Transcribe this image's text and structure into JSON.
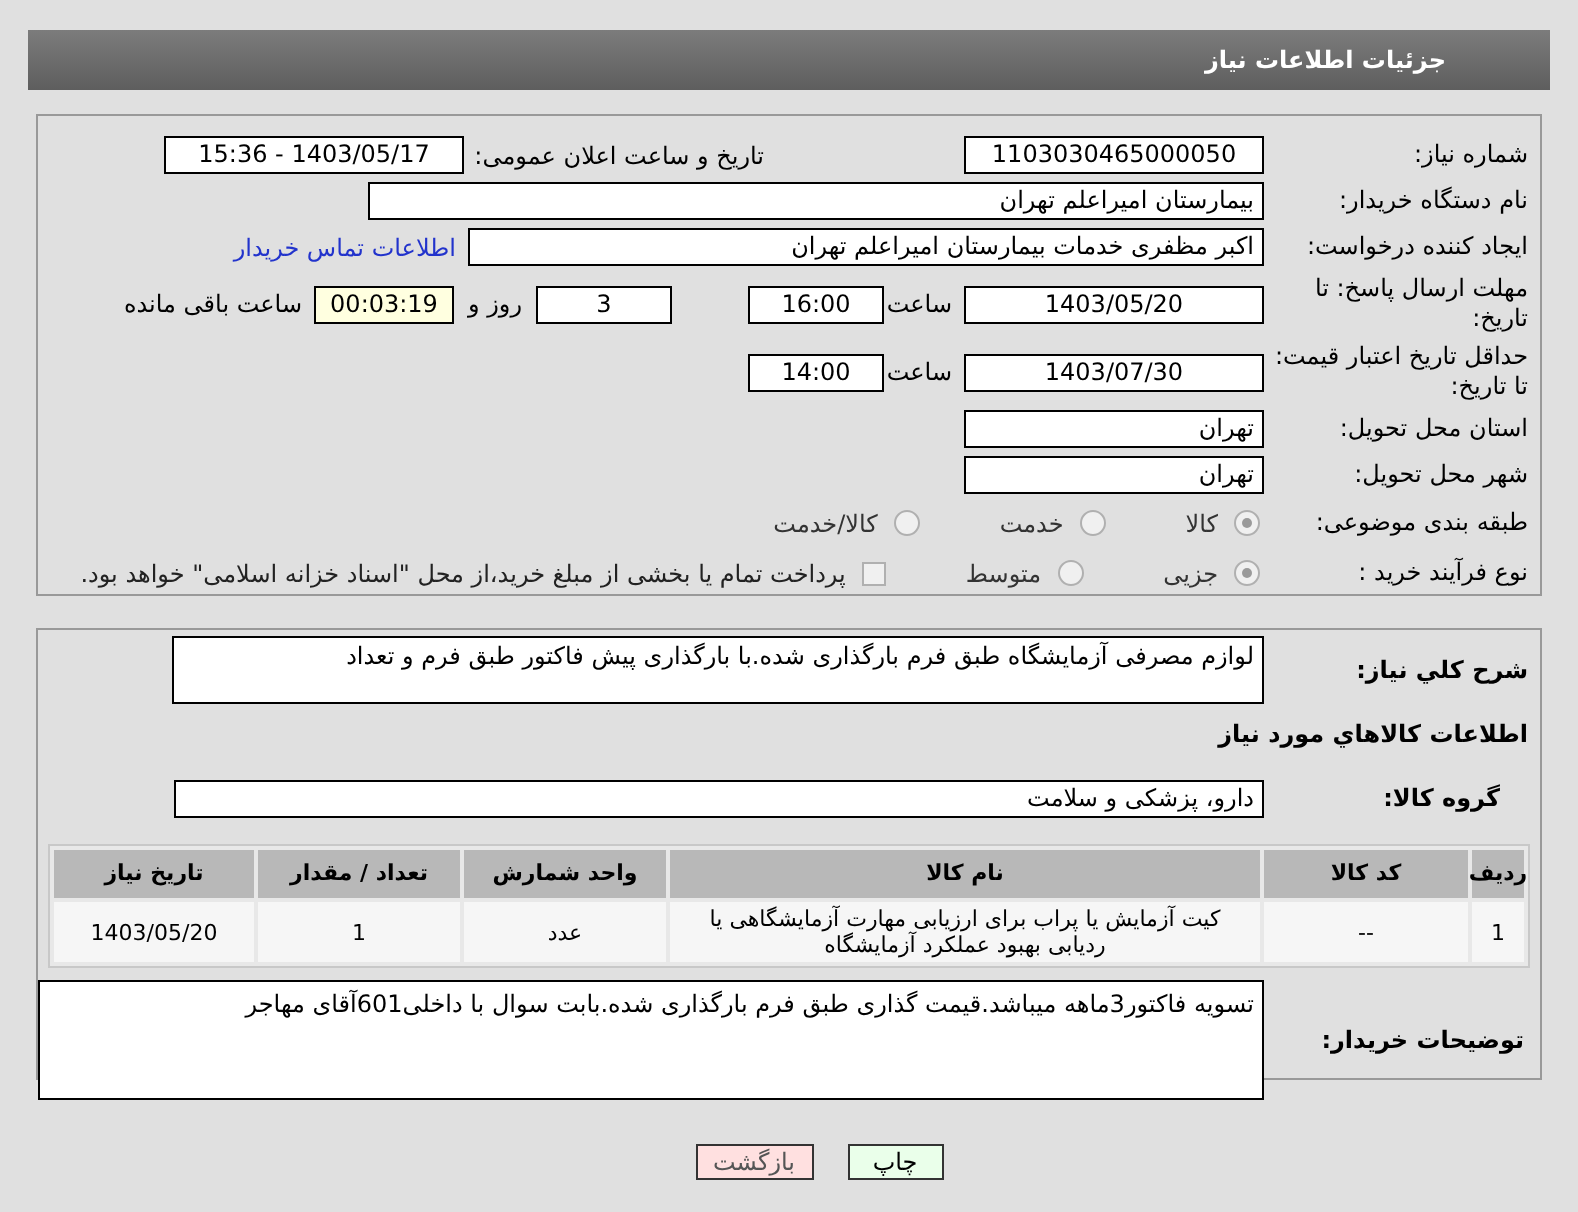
{
  "header": {
    "title": "جزئیات اطلاعات نیاز"
  },
  "need_number": {
    "label": "شماره نیاز:",
    "value": "1103030465000050"
  },
  "announce": {
    "label": "تاریخ و ساعت اعلان عمومی:",
    "value": "1403/05/17 - 15:36"
  },
  "buyer_org": {
    "label": "نام دستگاه خریدار:",
    "value": "بیمارستان امیراعلم تهران"
  },
  "requester": {
    "label": "ایجاد کننده درخواست:",
    "value": "اکبر مظفری خدمات بیمارستان امیراعلم تهران",
    "link": "اطلاعات تماس خریدار"
  },
  "reply_deadline": {
    "label": "مهلت ارسال پاسخ: تا تاریخ:",
    "date": "1403/05/20",
    "time_label": "ساعت",
    "time": "16:00",
    "days": "3",
    "days_label": "روز و",
    "remaining": "00:03:19",
    "remaining_label": "ساعت باقی مانده"
  },
  "price_validity": {
    "label": "حداقل تاریخ اعتبار قیمت: تا تاریخ:",
    "date": "1403/07/30",
    "time_label": "ساعت",
    "time": "14:00"
  },
  "province": {
    "label": "استان محل تحویل:",
    "value": "تهران"
  },
  "city": {
    "label": "شهر محل تحویل:",
    "value": "تهران"
  },
  "category": {
    "label": "طبقه بندی موضوعی:",
    "options": [
      {
        "label": "کالا",
        "selected": true
      },
      {
        "label": "خدمت",
        "selected": false
      },
      {
        "label": "کالا/خدمت",
        "selected": false
      }
    ]
  },
  "process": {
    "label": "نوع فرآیند خرید :",
    "options": [
      {
        "label": "جزیی",
        "selected": true
      },
      {
        "label": "متوسط",
        "selected": false
      }
    ],
    "treasury": {
      "label": "پرداخت تمام یا بخشی از مبلغ خرید،از محل \"اسناد خزانه اسلامی\" خواهد بود.",
      "checked": false
    }
  },
  "description": {
    "label": "شرح كلي نياز:",
    "value": "لوازم مصرفی آزمایشگاه طبق فرم بارگذاری شده.با بارگذاری پیش فاکتور طبق فرم و تعداد"
  },
  "goods_heading": "اطلاعات كالاهاي مورد نياز",
  "goods_group": {
    "label": "گروه کالا:",
    "value": "دارو، پزشکی و سلامت"
  },
  "table": {
    "columns": [
      "ردیف",
      "کد کالا",
      "نام کالا",
      "واحد شمارش",
      "تعداد / مقدار",
      "تاریخ نیاز"
    ],
    "rows": [
      [
        "1",
        "--",
        "کیت آزمایش یا پراب برای ارزیابی مهارت آزمایشگاهی یا ردیابی بهبود عملکرد آزمایشگاه",
        "عدد",
        "1",
        "1403/05/20"
      ]
    ]
  },
  "buyer_notes": {
    "label": "توضیحات خریدار:",
    "value": "تسویه فاکتور3ماهه میباشد.قیمت گذاری طبق فرم بارگذاری شده.بابت سوال با داخلی601آقای مهاجر"
  },
  "buttons": [
    {
      "label": "چاپ",
      "kind": "print"
    },
    {
      "label": "بازگشت",
      "kind": "back"
    }
  ]
}
